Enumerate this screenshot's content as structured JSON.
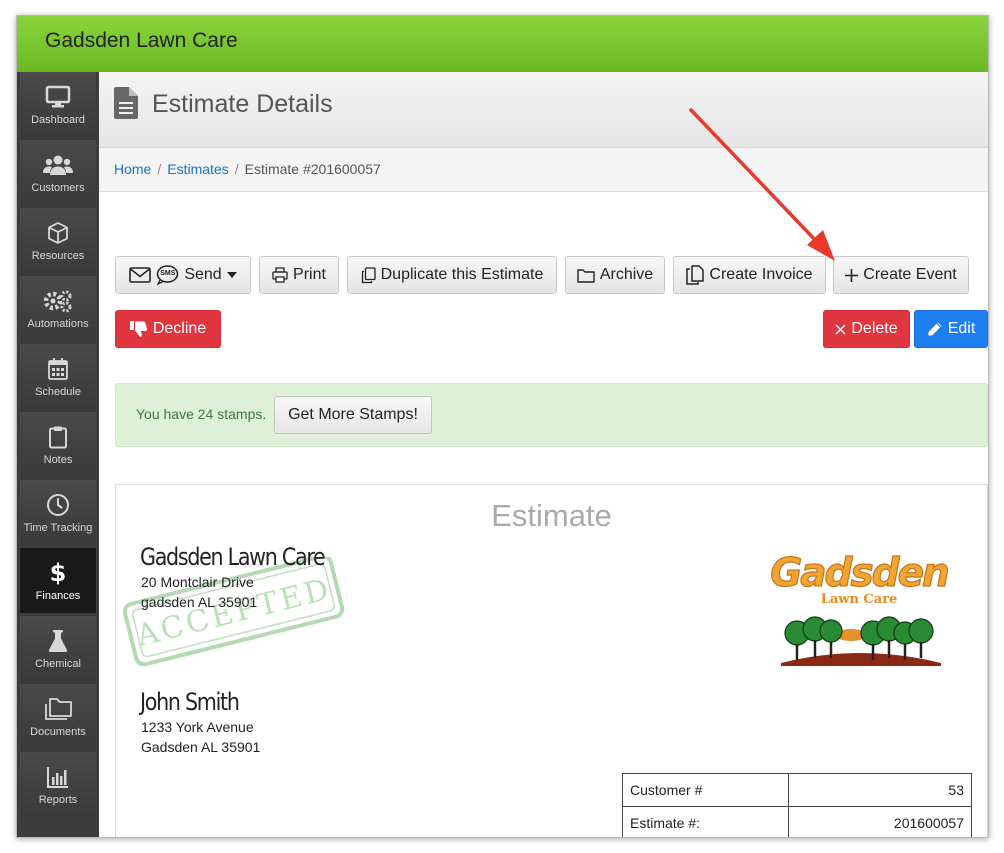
{
  "app": {
    "brand": "Gadsden Lawn Care"
  },
  "sidebar": {
    "items": [
      {
        "label": "Dashboard",
        "icon": "monitor-icon"
      },
      {
        "label": "Customers",
        "icon": "users-icon"
      },
      {
        "label": "Resources",
        "icon": "cube-icon"
      },
      {
        "label": "Automations",
        "icon": "gears-icon"
      },
      {
        "label": "Schedule",
        "icon": "calendar-icon"
      },
      {
        "label": "Notes",
        "icon": "clipboard-icon"
      },
      {
        "label": "Time Tracking",
        "icon": "clock-icon"
      },
      {
        "label": "Finances",
        "icon": "dollar-icon",
        "active": true
      },
      {
        "label": "Chemical",
        "icon": "flask-icon"
      },
      {
        "label": "Documents",
        "icon": "folders-icon"
      },
      {
        "label": "Reports",
        "icon": "bar-chart-icon"
      }
    ]
  },
  "header": {
    "title": "Estimate Details",
    "icon": "document-icon"
  },
  "breadcrumb": {
    "home": "Home",
    "estimates": "Estimates",
    "current": "Estimate #201600057"
  },
  "toolbar": {
    "send": "Send",
    "sms_badge": "SMS",
    "print": "Print",
    "duplicate": "Duplicate this Estimate",
    "archive": "Archive",
    "create_invoice": "Create Invoice",
    "create_event": "Create Event",
    "decline": "Decline",
    "delete": "Delete",
    "edit": "Edit"
  },
  "alert": {
    "text": "You have 24 stamps.",
    "button": "Get More Stamps!"
  },
  "estimate": {
    "heading": "Estimate",
    "company": {
      "name": "Gadsden Lawn Care",
      "address1": "20 Montclair Drive",
      "address2": "gadsden AL 35901"
    },
    "stamp": "ACCEPTED",
    "logo": {
      "line1": "Gadsden",
      "line2": "Lawn Care"
    },
    "customer": {
      "name": "John Smith",
      "address1": "1233 York Avenue",
      "address2": "Gadsden AL 35901"
    },
    "info": [
      {
        "label": "Customer #",
        "value": "53"
      },
      {
        "label": "Estimate #:",
        "value": "201600057"
      }
    ]
  },
  "colors": {
    "topbar": "#7ac630",
    "danger": "#e0363f",
    "primary": "#1d7ef0",
    "alert_bg": "#dff0d8",
    "annotation_arrow": "#e8392c"
  }
}
